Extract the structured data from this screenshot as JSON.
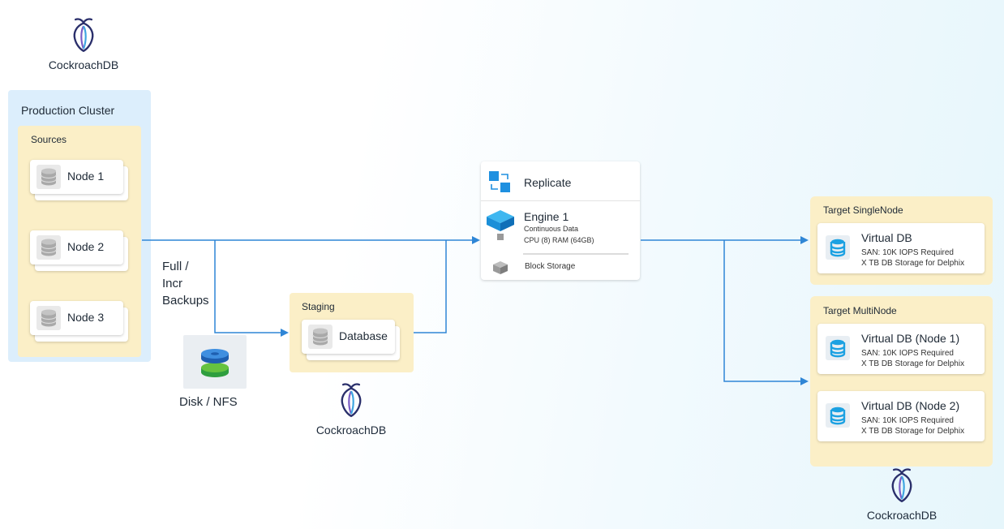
{
  "logos": {
    "top_left": "CockroachDB",
    "bottom_middle": "CockroachDB",
    "bottom_right": "CockroachDB",
    "icon": "cockroach-logo-icon"
  },
  "production_cluster": {
    "title": "Production Cluster",
    "sources": {
      "title": "Sources",
      "nodes": [
        {
          "label": "Node 1",
          "icon": "database-icon"
        },
        {
          "label": "Node 2",
          "icon": "database-icon"
        },
        {
          "label": "Node 3",
          "icon": "database-icon"
        }
      ]
    }
  },
  "backup_label": [
    "Full /",
    "Incr",
    "Backups"
  ],
  "disk": {
    "label": "Disk / NFS",
    "icon": "disk-stack-icon"
  },
  "staging": {
    "title": "Staging",
    "database_label": "Database",
    "icon": "database-icon"
  },
  "engine": {
    "replicate_label": "Replicate",
    "replicate_icon": "replicate-icon",
    "engine_title": "Engine 1",
    "engine_line1": "Continuous Data",
    "engine_line2": "CPU (8) RAM (64GB)",
    "engine_icon": "engine-cube-icon",
    "storage_label": "Block Storage",
    "storage_icon": "block-storage-icon"
  },
  "targets": {
    "single": {
      "title": "Target SingleNode",
      "vdbs": [
        {
          "title": "Virtual DB",
          "line1": "SAN: 10K IOPS Required",
          "line2": "X TB DB Storage for Delphix"
        }
      ]
    },
    "multi": {
      "title": "Target MultiNode",
      "vdbs": [
        {
          "title": "Virtual DB (Node 1)",
          "line1": "SAN: 10K IOPS Required",
          "line2": "X TB DB Storage for Delphix"
        },
        {
          "title": "Virtual DB (Node 2)",
          "line1": "SAN: 10K IOPS Required",
          "line2": "X TB DB Storage for Delphix"
        }
      ]
    }
  },
  "colors": {
    "connector": "#2f86d6",
    "production_bg": "#dceefc",
    "group_bg": "#fbefc7",
    "logo": "#2a2f6b",
    "vdb_icon": "#1ba1e2"
  }
}
